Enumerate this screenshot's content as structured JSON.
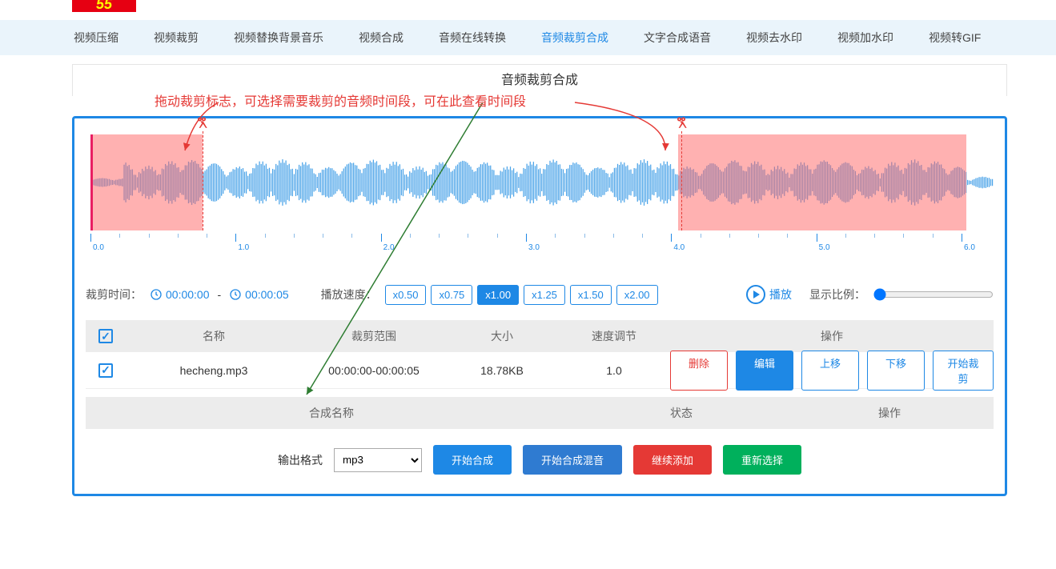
{
  "nav": {
    "items": [
      "视频压缩",
      "视频裁剪",
      "视频替换背景音乐",
      "视频合成",
      "音频在线转换",
      "音频裁剪合成",
      "文字合成语音",
      "视频去水印",
      "视频加水印",
      "视频转GIF"
    ],
    "active_index": 5
  },
  "section_title": "音频裁剪合成",
  "hint1": "拖动裁剪标志，可选择需要裁剪的音频时间段，",
  "hint2": "可在此查看时间段",
  "timeline": {
    "ticks": [
      "0.0",
      "1.0",
      "2.0",
      "3.0",
      "4.0",
      "5.0",
      "6.0"
    ]
  },
  "controls": {
    "cut_label": "裁剪时间：",
    "cut_start": "00:00:00",
    "cut_end": "00:00:05",
    "speed_label": "播放速度：",
    "speeds": [
      "x0.50",
      "x0.75",
      "x1.00",
      "x1.25",
      "x1.50",
      "x2.00"
    ],
    "active_speed_index": 2,
    "play_label": "播放",
    "zoom_label": "显示比例："
  },
  "table": {
    "headers": {
      "name": "名称",
      "range": "裁剪范围",
      "size": "大小",
      "speed": "速度调节",
      "ops": "操作"
    },
    "rows": [
      {
        "name": "hecheng.mp3",
        "range": "00:00:00-00:00:05",
        "size": "18.78KB",
        "speed": "1.0"
      }
    ],
    "ops": {
      "delete": "删除",
      "edit": "编辑",
      "up": "上移",
      "down": "下移",
      "start_cut": "开始裁剪"
    }
  },
  "table2": {
    "name": "合成名称",
    "status": "状态",
    "ops": "操作"
  },
  "footer": {
    "format_label": "输出格式",
    "format_value": "mp3",
    "start_combine": "开始合成",
    "start_mix": "开始合成混音",
    "add_more": "继续添加",
    "reselect": "重新选择"
  }
}
